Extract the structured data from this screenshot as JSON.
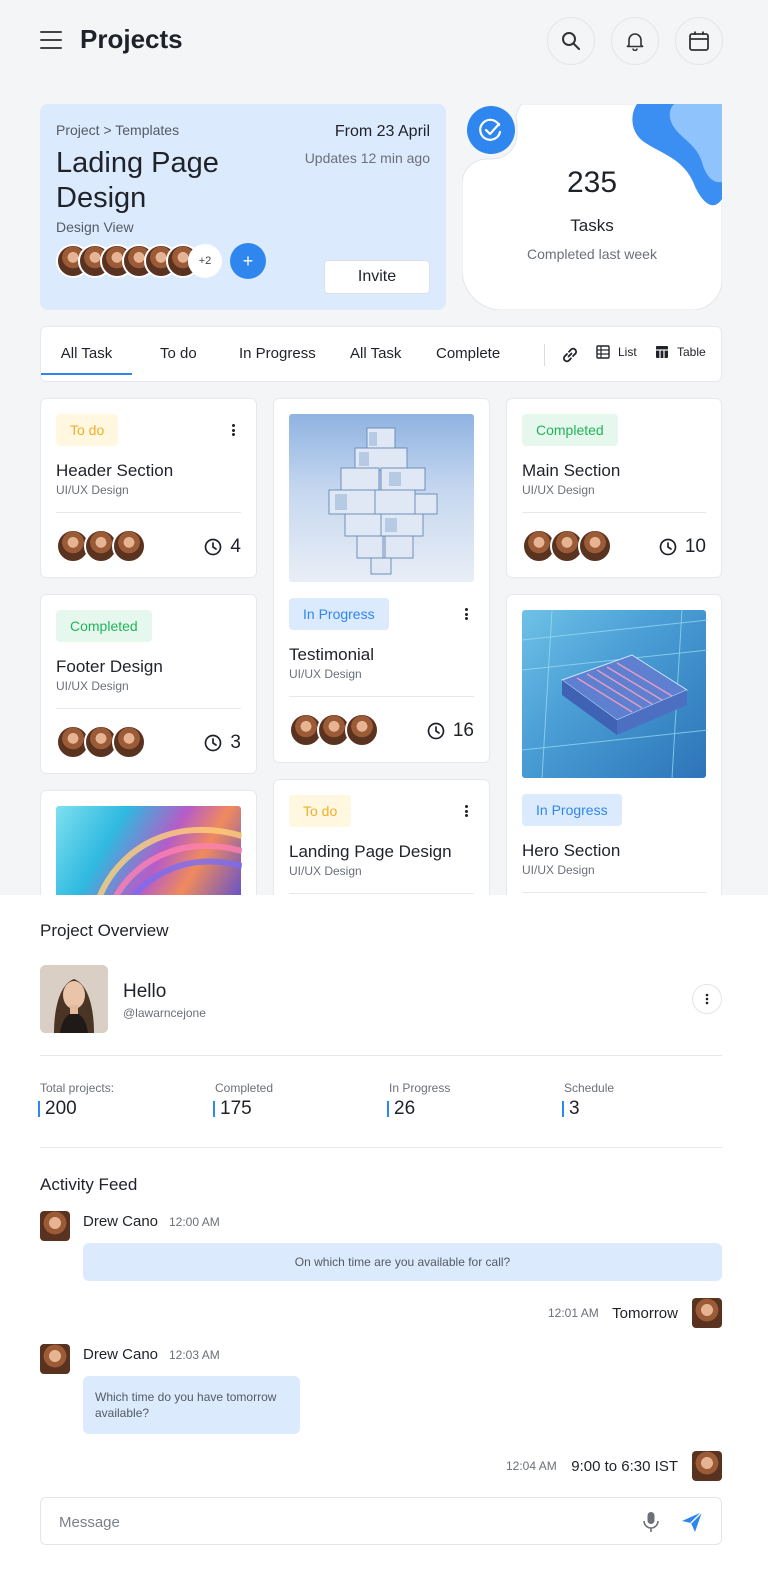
{
  "header": {
    "title": "Projects",
    "icons": [
      "menu-icon",
      "search-icon",
      "bell-icon",
      "calendar-icon"
    ]
  },
  "project": {
    "breadcrumb": "Project > Templates",
    "title": "Lading Page Design",
    "subtitle": "Design View",
    "date": "From 23 April",
    "updated": "Updates 12 min ago",
    "members_more": "+2",
    "add_label": "+",
    "invite_label": "Invite"
  },
  "stats": {
    "value": "235",
    "label": "Tasks",
    "caption": "Completed last week"
  },
  "tabs": [
    {
      "label": "All Task",
      "active": true
    },
    {
      "label": "To do"
    },
    {
      "label": "In Progress"
    },
    {
      "label": "All Task"
    },
    {
      "label": "Complete"
    }
  ],
  "tools": {
    "list_label": "List",
    "table_label": "Table"
  },
  "tasks": [
    {
      "status": "To do",
      "title": "Header Section",
      "category": "UI/UX Design",
      "count": "4"
    },
    {
      "status": "In Progress",
      "title": "Testimonial",
      "category": "UI/UX Design",
      "count": "16"
    },
    {
      "status": "Completed",
      "title": "Main Section",
      "category": "UI/UX Design",
      "count": "10"
    },
    {
      "status": "Completed",
      "title": "Footer Design",
      "category": "UI/UX Design",
      "count": "3"
    },
    {
      "status": "In Progress",
      "title": "Hero Section",
      "category": "UI/UX Design"
    },
    {
      "status": "To do",
      "title": "Landing Page Design",
      "category": "UI/UX Design"
    }
  ],
  "colors": {
    "accent": "#2f86ef",
    "todo": "#efb02b",
    "completed": "#22b35a"
  },
  "overview": {
    "title": "Project Overview",
    "greeting": "Hello",
    "handle": "@lawarncejone",
    "metrics": [
      {
        "label": "Total projects:",
        "value": "200"
      },
      {
        "label": "Completed",
        "value": "175"
      },
      {
        "label": "In Progress",
        "value": "26"
      },
      {
        "label": "Schedule",
        "value": "3"
      }
    ]
  },
  "activity": {
    "title": "Activity Feed",
    "messages": [
      {
        "name": "Drew Cano",
        "time": "12:00 AM",
        "text": "On which time are you available for call?"
      },
      {
        "time": "12:01 AM",
        "text": "Tomorrow"
      },
      {
        "name": "Drew Cano",
        "time": "12:03 AM",
        "text": "Which time do you have tomorrow available?"
      },
      {
        "time": "12:04 AM",
        "text": "9:00 to 6:30 IST"
      }
    ],
    "input_placeholder": "Message"
  }
}
